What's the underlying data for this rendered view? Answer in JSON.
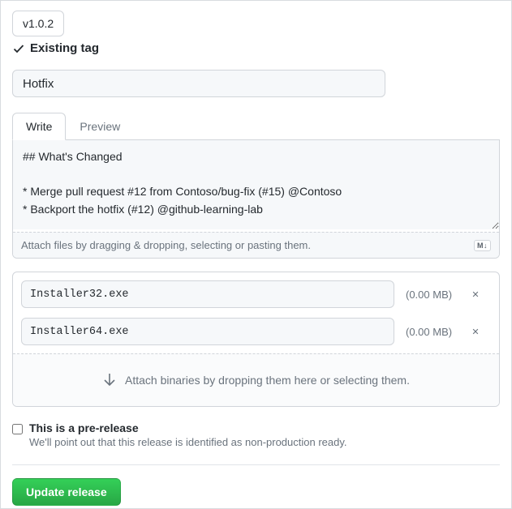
{
  "tag": {
    "name": "v1.0.2",
    "status": "Existing tag"
  },
  "title": "Hotfix",
  "tabs": {
    "write": "Write",
    "preview": "Preview"
  },
  "description": "## What's Changed\n\n* Merge pull request #12 from Contoso/bug-fix (#15) @Contoso\n* Backport the hotfix (#12) @github-learning-lab",
  "attach_hint": "Attach files by dragging & dropping, selecting or pasting them.",
  "md_badge": "M↓",
  "assets": [
    {
      "name": "Installer32.exe",
      "size": "(0.00 MB)"
    },
    {
      "name": "Installer64.exe",
      "size": "(0.00 MB)"
    }
  ],
  "dropzone": "Attach binaries by dropping them here or selecting them.",
  "prerelease": {
    "checked": false,
    "label": "This is a pre-release",
    "hint": "We'll point out that this release is identified as non-production ready."
  },
  "submit": "Update release"
}
